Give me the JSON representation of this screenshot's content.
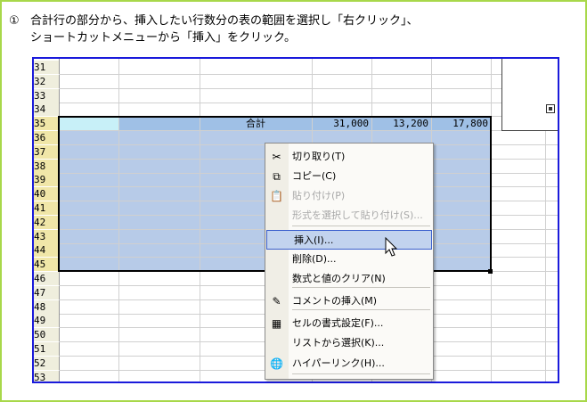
{
  "instruction": {
    "number": "①",
    "line1": "合計行の部分から、挿入したい行数分の表の範囲を選択し「右クリック」、",
    "line2": "ショートカットメニューから「挿入」をクリック。"
  },
  "sheet": {
    "rows": [
      "31",
      "32",
      "33",
      "34",
      "35",
      "36",
      "37",
      "38",
      "39",
      "40",
      "41",
      "42",
      "43",
      "44",
      "45",
      "46",
      "47",
      "48",
      "49",
      "50",
      "51",
      "52",
      "53"
    ],
    "total_label": "合計",
    "total_values": [
      "31,000",
      "13,200",
      "17,800"
    ]
  },
  "context_menu": {
    "items": [
      {
        "label": "切り取り(T)",
        "icon": "scissors-icon",
        "glyph": "✂",
        "disabled": false
      },
      {
        "label": "コピー(C)",
        "icon": "copy-icon",
        "glyph": "⧉",
        "disabled": false
      },
      {
        "label": "貼り付け(P)",
        "icon": "paste-icon",
        "glyph": "📋",
        "disabled": true
      },
      {
        "label": "形式を選択して貼り付け(S)...",
        "icon": "",
        "glyph": "",
        "disabled": true
      },
      {
        "label": "挿入(I)...",
        "icon": "",
        "glyph": "",
        "disabled": false,
        "highlighted": true
      },
      {
        "label": "削除(D)...",
        "icon": "",
        "glyph": "",
        "disabled": false
      },
      {
        "label": "数式と値のクリア(N)",
        "icon": "",
        "glyph": "",
        "disabled": false
      },
      {
        "label": "コメントの挿入(M)",
        "icon": "comment-icon",
        "glyph": "✎",
        "disabled": false
      },
      {
        "label": "セルの書式設定(F)...",
        "icon": "format-cells-icon",
        "glyph": "▦",
        "disabled": false
      },
      {
        "label": "リストから選択(K)...",
        "icon": "",
        "glyph": "",
        "disabled": false
      },
      {
        "label": "ハイパーリンク(H)...",
        "icon": "hyperlink-icon",
        "glyph": "🌐",
        "disabled": false
      }
    ]
  },
  "colors": {
    "selection": "#b7cbe8",
    "total_row": "#9fc0e6",
    "frame": "#a8d84a",
    "box": "#1a1adb"
  }
}
